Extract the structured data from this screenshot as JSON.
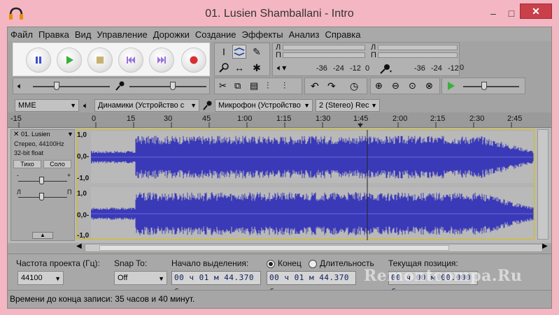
{
  "window": {
    "title": "01. Lusien Shamballani - Intro",
    "minimize_glyph": "–",
    "maximize_glyph": "□",
    "close_glyph": "✕",
    "frame_color": "#f4b6c2"
  },
  "menu": [
    {
      "label": "Файл"
    },
    {
      "label": "Правка"
    },
    {
      "label": "Вид"
    },
    {
      "label": "Управление"
    },
    {
      "label": "Дорожки"
    },
    {
      "label": "Создание"
    },
    {
      "label": "Эффекты"
    },
    {
      "label": "Анализ"
    },
    {
      "label": "Справка"
    }
  ],
  "transport": {
    "buttons": [
      {
        "name": "pause-icon",
        "color": "#3c4fd0"
      },
      {
        "name": "play-icon",
        "color": "#3ab03a"
      },
      {
        "name": "stop-icon",
        "color": "#c8b070"
      },
      {
        "name": "skip-start-icon",
        "color": "#9a70e0"
      },
      {
        "name": "skip-end-icon",
        "color": "#9a70e0"
      },
      {
        "name": "record-icon",
        "color": "#d83030"
      }
    ]
  },
  "meters": {
    "playback_ticks": [
      "-36",
      "-24",
      "-12",
      "0"
    ],
    "record_ticks": [
      "-36",
      "-24",
      "-12",
      "0"
    ],
    "channel_l": "Л",
    "channel_r": "П"
  },
  "devices": {
    "host": "MME",
    "output": "Динамики (Устройство с",
    "input": "Микрофон (Устройство",
    "channels": "2 (Stereo) Rec"
  },
  "ruler": {
    "labels": [
      "-15",
      "0",
      "15",
      "30",
      "45",
      "1:00",
      "1:15",
      "1:30",
      "1:45",
      "2:00",
      "2:15",
      "2:30",
      "2:45"
    ]
  },
  "track": {
    "name": "01. Lusien",
    "info_line1": "Стерео, 44100Hz",
    "info_line2": "32-bit float",
    "mute_label": "Тихо",
    "solo_label": "Соло",
    "gain_minus": "-",
    "gain_plus": "+",
    "pan_left": "Л",
    "pan_right": "П",
    "scale_top": "1,0",
    "scale_mid": "0,0-",
    "scale_bottom": "-1,0",
    "wave_color": "#3a3ab8"
  },
  "selection": {
    "rate_label": "Частота проекта (Гц):",
    "rate_value": "44100",
    "snap_label": "Snap To:",
    "snap_value": "Off",
    "start_label": "Начало выделения:",
    "end_radio": "Конец",
    "length_radio": "Длительность",
    "start_time": "00 ч 01 м 44.370 с",
    "end_time": "00 ч 01 м 44.370 с",
    "position_label": "Текущая позиция:",
    "position_time": "00 ч 00 м 00.000 с"
  },
  "status": {
    "text": "Времени до конца записи: 35 часов и 40 минут."
  },
  "watermark": "Remontcompa.Ru"
}
